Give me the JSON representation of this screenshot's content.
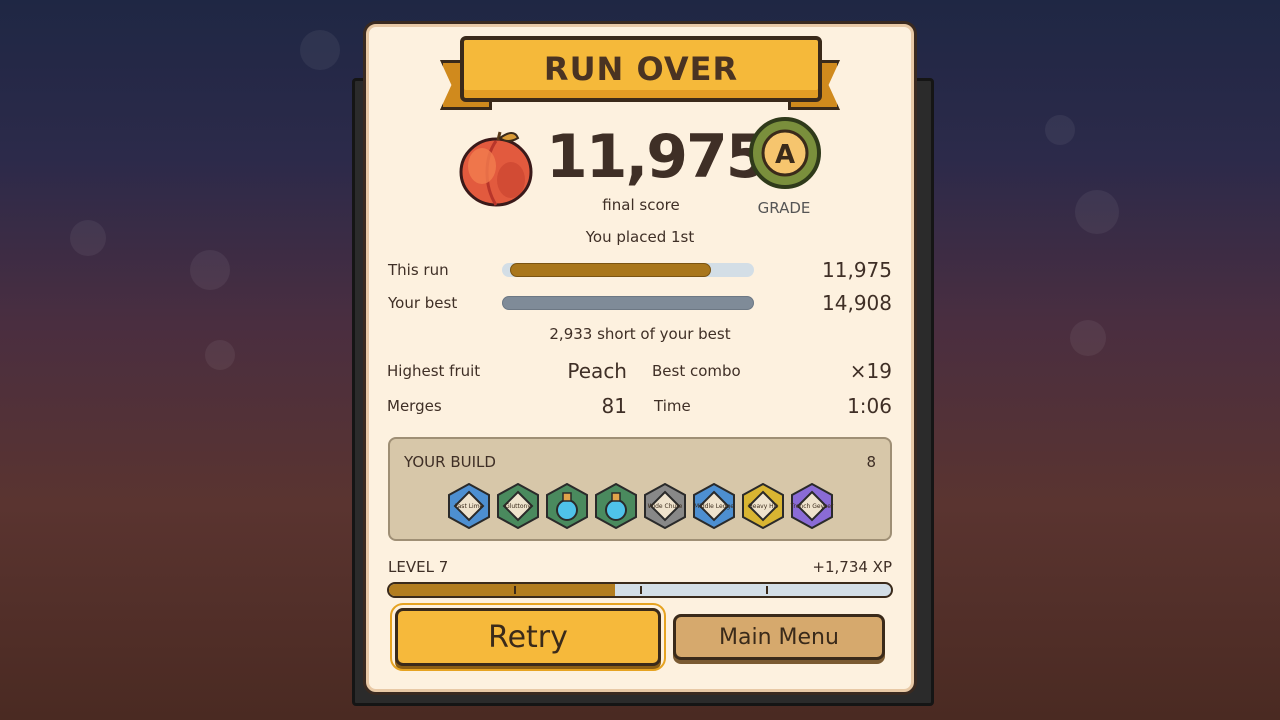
{
  "header": {
    "title": "RUN OVER"
  },
  "score": {
    "value": "11,975",
    "label": "final score",
    "fruit_icon": "peach-icon"
  },
  "grade": {
    "letter": "A",
    "label": "GRADE"
  },
  "placement": "You placed 1st",
  "comparison": {
    "this_run": {
      "label": "This run",
      "value": "11,975",
      "progress": 0.8
    },
    "best": {
      "label": "Your best",
      "value": "14,908",
      "progress": 1.0
    },
    "delta": "2,933 short of your best"
  },
  "stats": {
    "highest_fruit": {
      "label": "Highest fruit",
      "value": "Peach"
    },
    "best_combo": {
      "label": "Best combo",
      "value": "×19"
    },
    "merges": {
      "label": "Merges",
      "value": "81"
    },
    "time": {
      "label": "Time",
      "value": "1:06"
    }
  },
  "build": {
    "title": "YOUR BUILD",
    "count": "8",
    "items": [
      {
        "name": "Fast Lime",
        "color": "#4d8fd1",
        "icon": "diamond-card-icon"
      },
      {
        "name": "Gluttony",
        "color": "#4a8a5e",
        "icon": "diamond-card-icon"
      },
      {
        "name": "",
        "color": "#4a8a5e",
        "icon": "potion-icon"
      },
      {
        "name": "",
        "color": "#4a8a5e",
        "icon": "potion-icon"
      },
      {
        "name": "Wide Chute",
        "color": "#888888",
        "icon": "diamond-card-icon"
      },
      {
        "name": "Middle Ledge",
        "color": "#4d8fd1",
        "icon": "diamond-card-icon"
      },
      {
        "name": "Heavy Hit",
        "color": "#d9b532",
        "icon": "diamond-card-icon"
      },
      {
        "name": "Trench Geyser",
        "color": "#8a6bd6",
        "icon": "diamond-card-icon"
      }
    ]
  },
  "level": {
    "label": "LEVEL 7",
    "xp_gain": "+1,734 XP",
    "progress": 0.45
  },
  "buttons": {
    "retry": "Retry",
    "main_menu": "Main Menu"
  },
  "colors": {
    "accent": "#f6b93b",
    "panel": "#fdf1df",
    "bar_fill": "#a9761b",
    "best_bar": "#7f8b98"
  }
}
